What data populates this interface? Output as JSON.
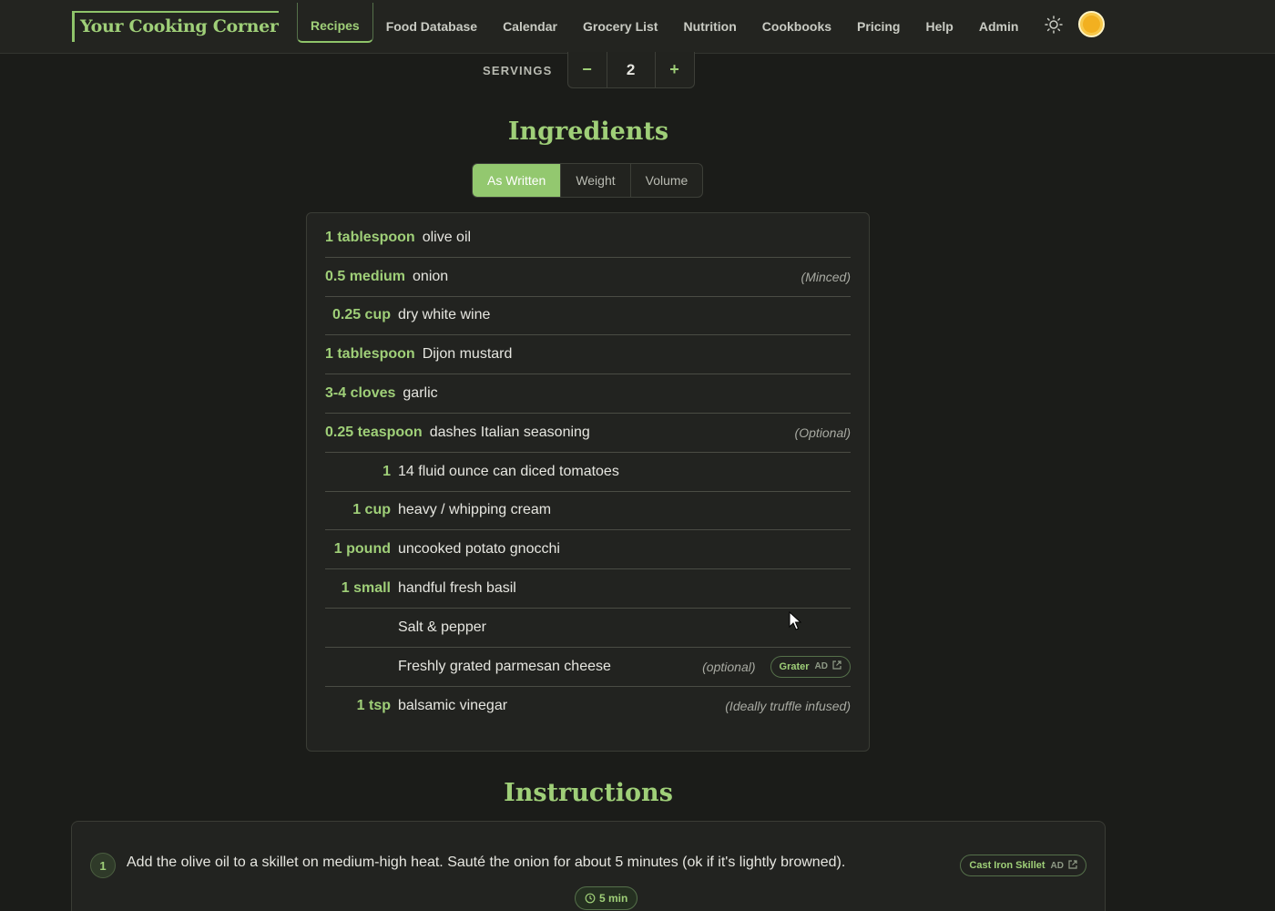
{
  "nav": {
    "logo": "Your Cooking Corner",
    "links": [
      "Recipes",
      "Food Database",
      "Calendar",
      "Grocery List",
      "Nutrition",
      "Cookbooks",
      "Pricing",
      "Help",
      "Admin"
    ],
    "active": "Recipes"
  },
  "servings": {
    "label": "SERVINGS",
    "value": "2",
    "minus": "−",
    "plus": "+"
  },
  "ingredients": {
    "title": "Ingredients",
    "units": [
      "As Written",
      "Weight",
      "Volume"
    ],
    "active_unit": "As Written",
    "items": [
      {
        "qty": "1 tablespoon",
        "name": "olive oil",
        "note": ""
      },
      {
        "qty": "0.5 medium",
        "name": "onion",
        "note": "(Minced)"
      },
      {
        "qty": "0.25 cup",
        "name": "dry white wine",
        "note": ""
      },
      {
        "qty": "1 tablespoon",
        "name": "Dijon mustard",
        "note": ""
      },
      {
        "qty": "3-4 cloves",
        "name": "garlic",
        "note": ""
      },
      {
        "qty": "0.25 teaspoon",
        "name": "dashes Italian seasoning",
        "note": "(Optional)"
      },
      {
        "qty": "1",
        "name": "14 fluid ounce can diced tomatoes",
        "note": ""
      },
      {
        "qty": "1 cup",
        "name": "heavy / whipping cream",
        "note": ""
      },
      {
        "qty": "1 pound",
        "name": "uncooked potato gnocchi",
        "note": ""
      },
      {
        "qty": "1 small",
        "name": "handful fresh basil",
        "note": ""
      },
      {
        "qty": "",
        "name": "Salt & pepper",
        "note": ""
      },
      {
        "qty": "",
        "name": "Freshly grated parmesan cheese",
        "note": "(optional)",
        "ad": "Grater"
      },
      {
        "qty": "1 tsp",
        "name": "balsamic vinegar",
        "note": "(Ideally truffle infused)"
      }
    ]
  },
  "instructions": {
    "title": "Instructions",
    "steps": [
      {
        "num": "1",
        "text": "Add the olive oil to a skillet on medium-high heat. Sauté the onion for about 5 minutes (ok if it's lightly browned).",
        "ad": "Cast Iron Skillet",
        "timer": "5 min"
      }
    ]
  },
  "ad_badge": "AD",
  "colors": {
    "accent": "#9fcf78",
    "background": "#1b1c19",
    "card": "#222320"
  },
  "icons": {
    "theme": "sun-icon",
    "external": "external-link-icon",
    "timer": "clock-icon",
    "cursor": "mouse-pointer-icon"
  }
}
